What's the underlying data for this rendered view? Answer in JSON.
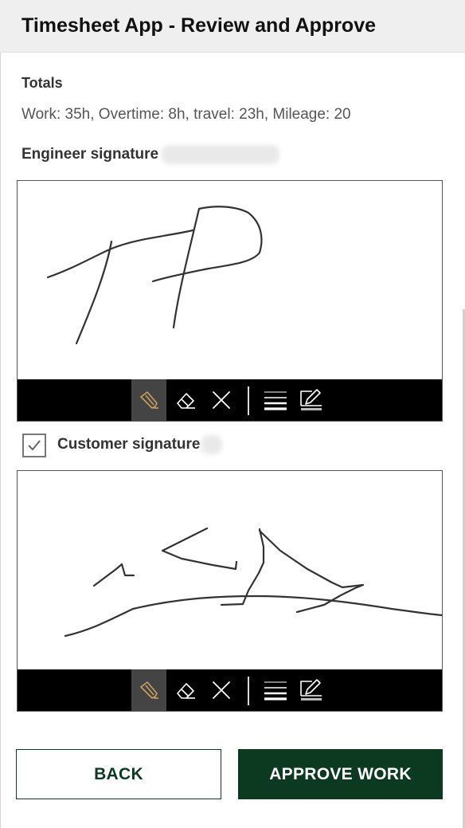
{
  "header": {
    "title": "Timesheet App - Review and Approve"
  },
  "totals": {
    "label": "Totals",
    "summary": "Work: 35h, Overtime: 8h, travel: 23h, Mileage: 20"
  },
  "engineer_signature": {
    "label": "Engineer signature"
  },
  "customer_signature": {
    "label": "Customer signature",
    "checked": true
  },
  "signature_toolbar": {
    "tools": [
      "pen-icon",
      "eraser-icon",
      "clear-icon",
      "line-width-icon",
      "pen-color-icon"
    ],
    "active_tool": "pen-icon"
  },
  "buttons": {
    "back": "BACK",
    "approve": "APPROVE WORK"
  },
  "colors": {
    "primary": "#0b3a21",
    "toolbar": "#000000",
    "active_tool": "#444444",
    "pen_accent": "#c8a060"
  }
}
